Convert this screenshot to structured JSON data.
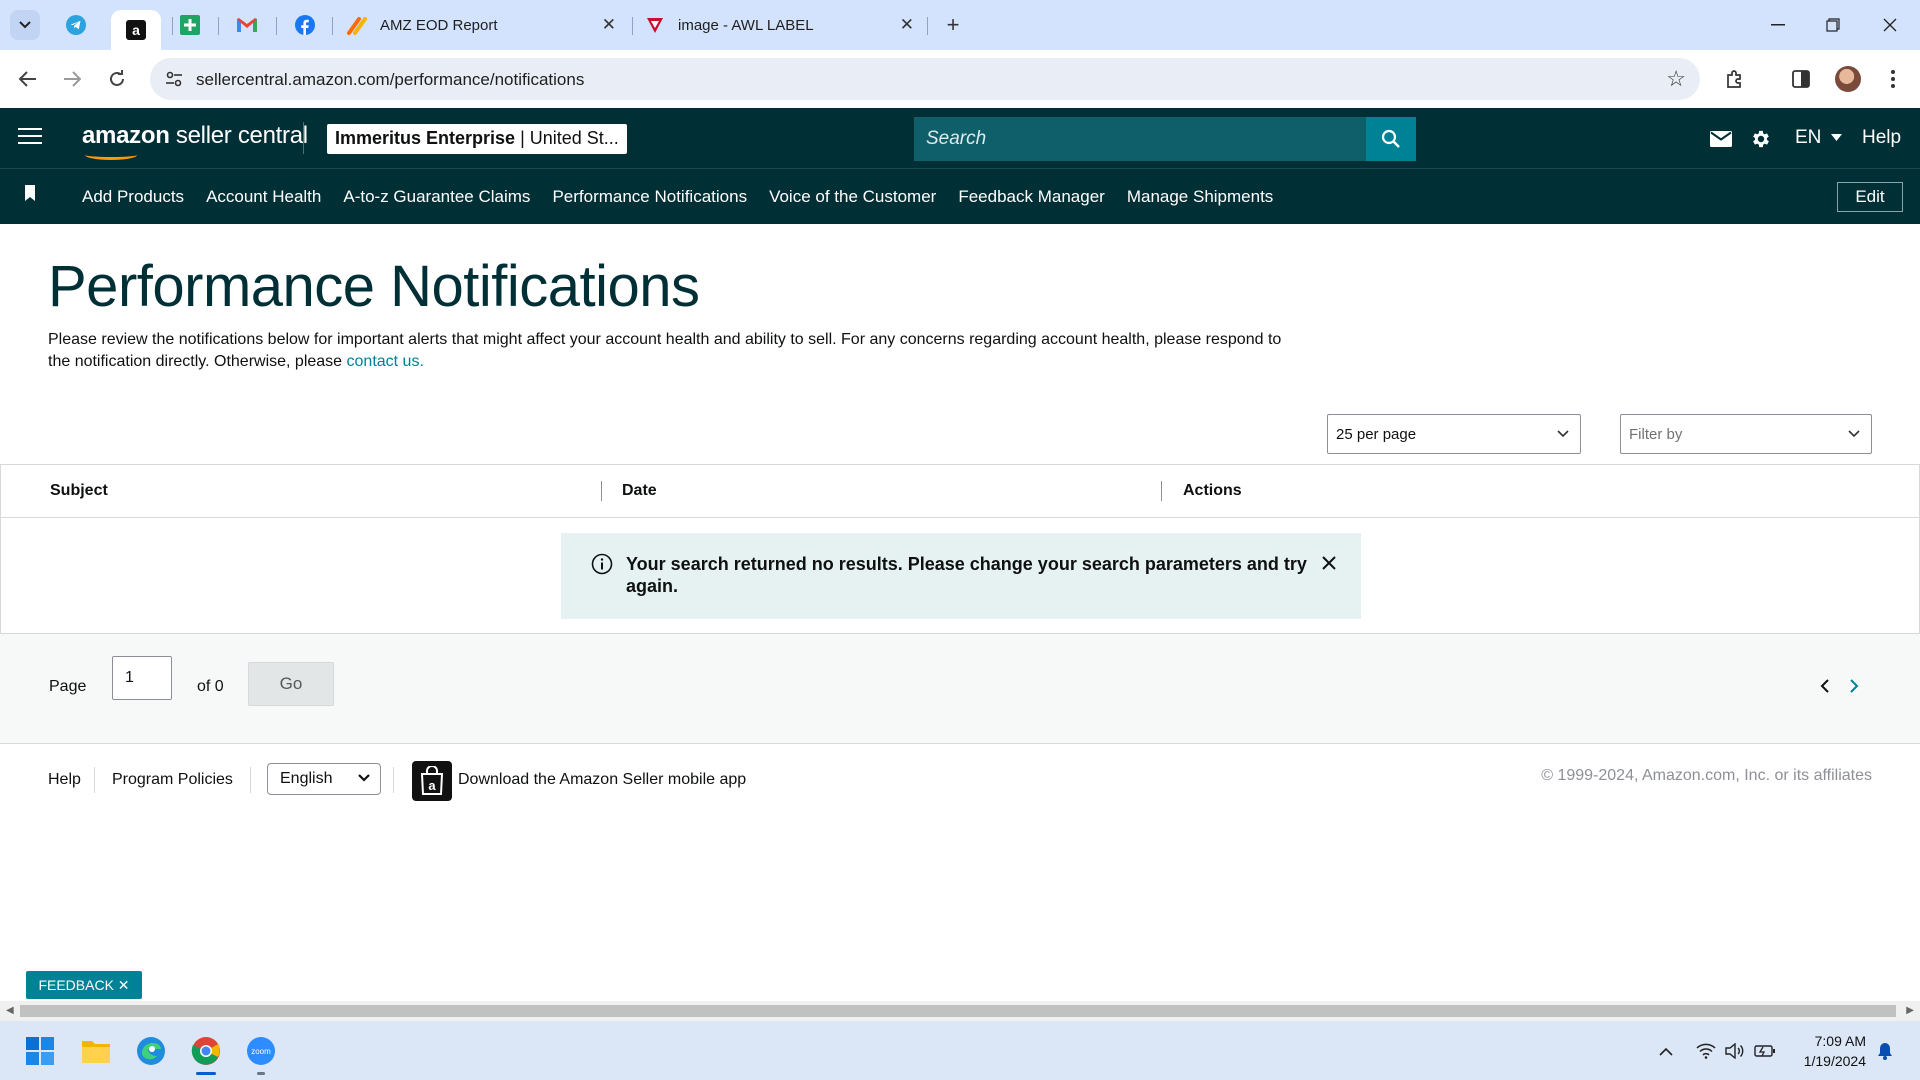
{
  "browser": {
    "tabs": [
      {
        "title": "AMZ EOD Report",
        "icon": "zapier-icon"
      },
      {
        "title": "image - AWL LABEL",
        "icon": "awl-icon"
      }
    ],
    "pinned_tabs": [
      "telegram-icon",
      "amazon-icon",
      "sheets-icon",
      "gmail-icon",
      "facebook-icon"
    ],
    "url": "sellercentral.amazon.com/performance/notifications"
  },
  "header": {
    "logo": {
      "bold": "amazon",
      "rest": " seller central"
    },
    "account": {
      "name": "Immeritus Enterprise",
      "region": " | United St..."
    },
    "search_placeholder": "Search",
    "language": "EN",
    "help": "Help",
    "nav": [
      "Add Products",
      "Account Health",
      "A-to-z Guarantee Claims",
      "Performance Notifications",
      "Voice of the Customer",
      "Feedback Manager",
      "Manage Shipments"
    ],
    "edit": "Edit"
  },
  "main": {
    "title": "Performance Notifications",
    "description": "Please review the notifications below for important alerts that might affect your account health and ability to sell. For any concerns regarding account health, please respond to the notification directly. Otherwise, please ",
    "contact_link": "contact us.",
    "per_page": "25 per page",
    "filter_placeholder": "Filter by",
    "columns": [
      "Subject",
      "Date",
      "Actions"
    ],
    "alert": "Your search returned no results. Please change your search parameters and try again.",
    "pager": {
      "label": "Page",
      "value": "1",
      "of": "of 0",
      "go": "Go"
    }
  },
  "footer": {
    "help": "Help",
    "policies": "Program Policies",
    "language": "English",
    "app_text": "Download the Amazon Seller mobile app",
    "copyright": "© 1999-2024, Amazon.com, Inc. or its affiliates"
  },
  "feedback": "FEEDBACK ✕",
  "taskbar": {
    "time": "7:09 AM",
    "date": "1/19/2024"
  },
  "colors": {
    "header_bg": "#002f36",
    "accent": "#008296",
    "alert_bg": "#e6f2f2",
    "chrome_tabstrip": "#d3e3fd"
  }
}
